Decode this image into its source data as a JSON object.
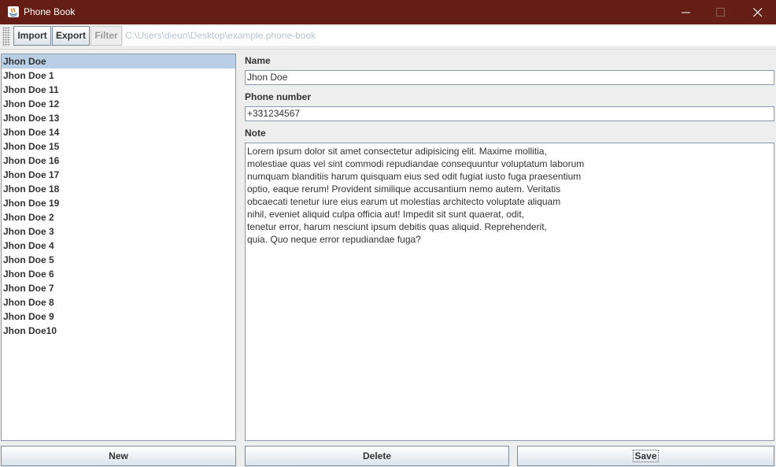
{
  "window": {
    "title": "Phone Book",
    "controls": [
      "minimize-icon",
      "maximize-icon",
      "close-icon"
    ]
  },
  "toolbar": {
    "import_label": "Import",
    "export_label": "Export",
    "filter_label": "Filter",
    "path_placeholder": "C:\\Users\\dieun\\Desktop\\example.phone-book"
  },
  "contacts": {
    "selected": "Jhon Doe",
    "items": [
      "Jhon Doe",
      "Jhon Doe 1",
      "Jhon Doe 11",
      "Jhon Doe 12",
      "Jhon Doe 13",
      "Jhon Doe 14",
      "Jhon Doe 15",
      "Jhon Doe 16",
      "Jhon Doe 17",
      "Jhon Doe 18",
      "Jhon Doe 19",
      "Jhon Doe 2",
      "Jhon Doe 3",
      "Jhon Doe 4",
      "Jhon Doe 5",
      "Jhon Doe 6",
      "Jhon Doe 7",
      "Jhon Doe 8",
      "Jhon Doe 9",
      "Jhon Doe10"
    ]
  },
  "form": {
    "name_label": "Name",
    "name_value": "Jhon Doe",
    "phone_label": "Phone number",
    "phone_value": "+331234567",
    "note_label": "Note",
    "note_lines": [
      "Lorem ipsum dolor sit amet consectetur adipisicing elit. Maxime mollitia,",
      "molestiae quas vel sint commodi repudiandae consequuntur voluptatum laborum",
      "numquam blanditiis harum quisquam eius sed odit fugiat iusto fuga praesentium",
      "optio, eaque rerum! Provident similique accusantium nemo autem. Veritatis",
      "obcaecati tenetur iure eius earum ut molestias architecto voluptate aliquam",
      "nihil, eveniet aliquid culpa officia aut! Impedit sit sunt quaerat, odit,",
      "tenetur error, harum nesciunt ipsum debitis quas aliquid. Reprehenderit,",
      "quia. Quo neque error repudiandae fuga?"
    ]
  },
  "buttons": {
    "new_label": "New",
    "delete_label": "Delete",
    "save_label": "Save"
  },
  "colors": {
    "title_bar": "#641e16",
    "selection": "#b8cfe5",
    "disabled_text": "#9a9a9a"
  }
}
